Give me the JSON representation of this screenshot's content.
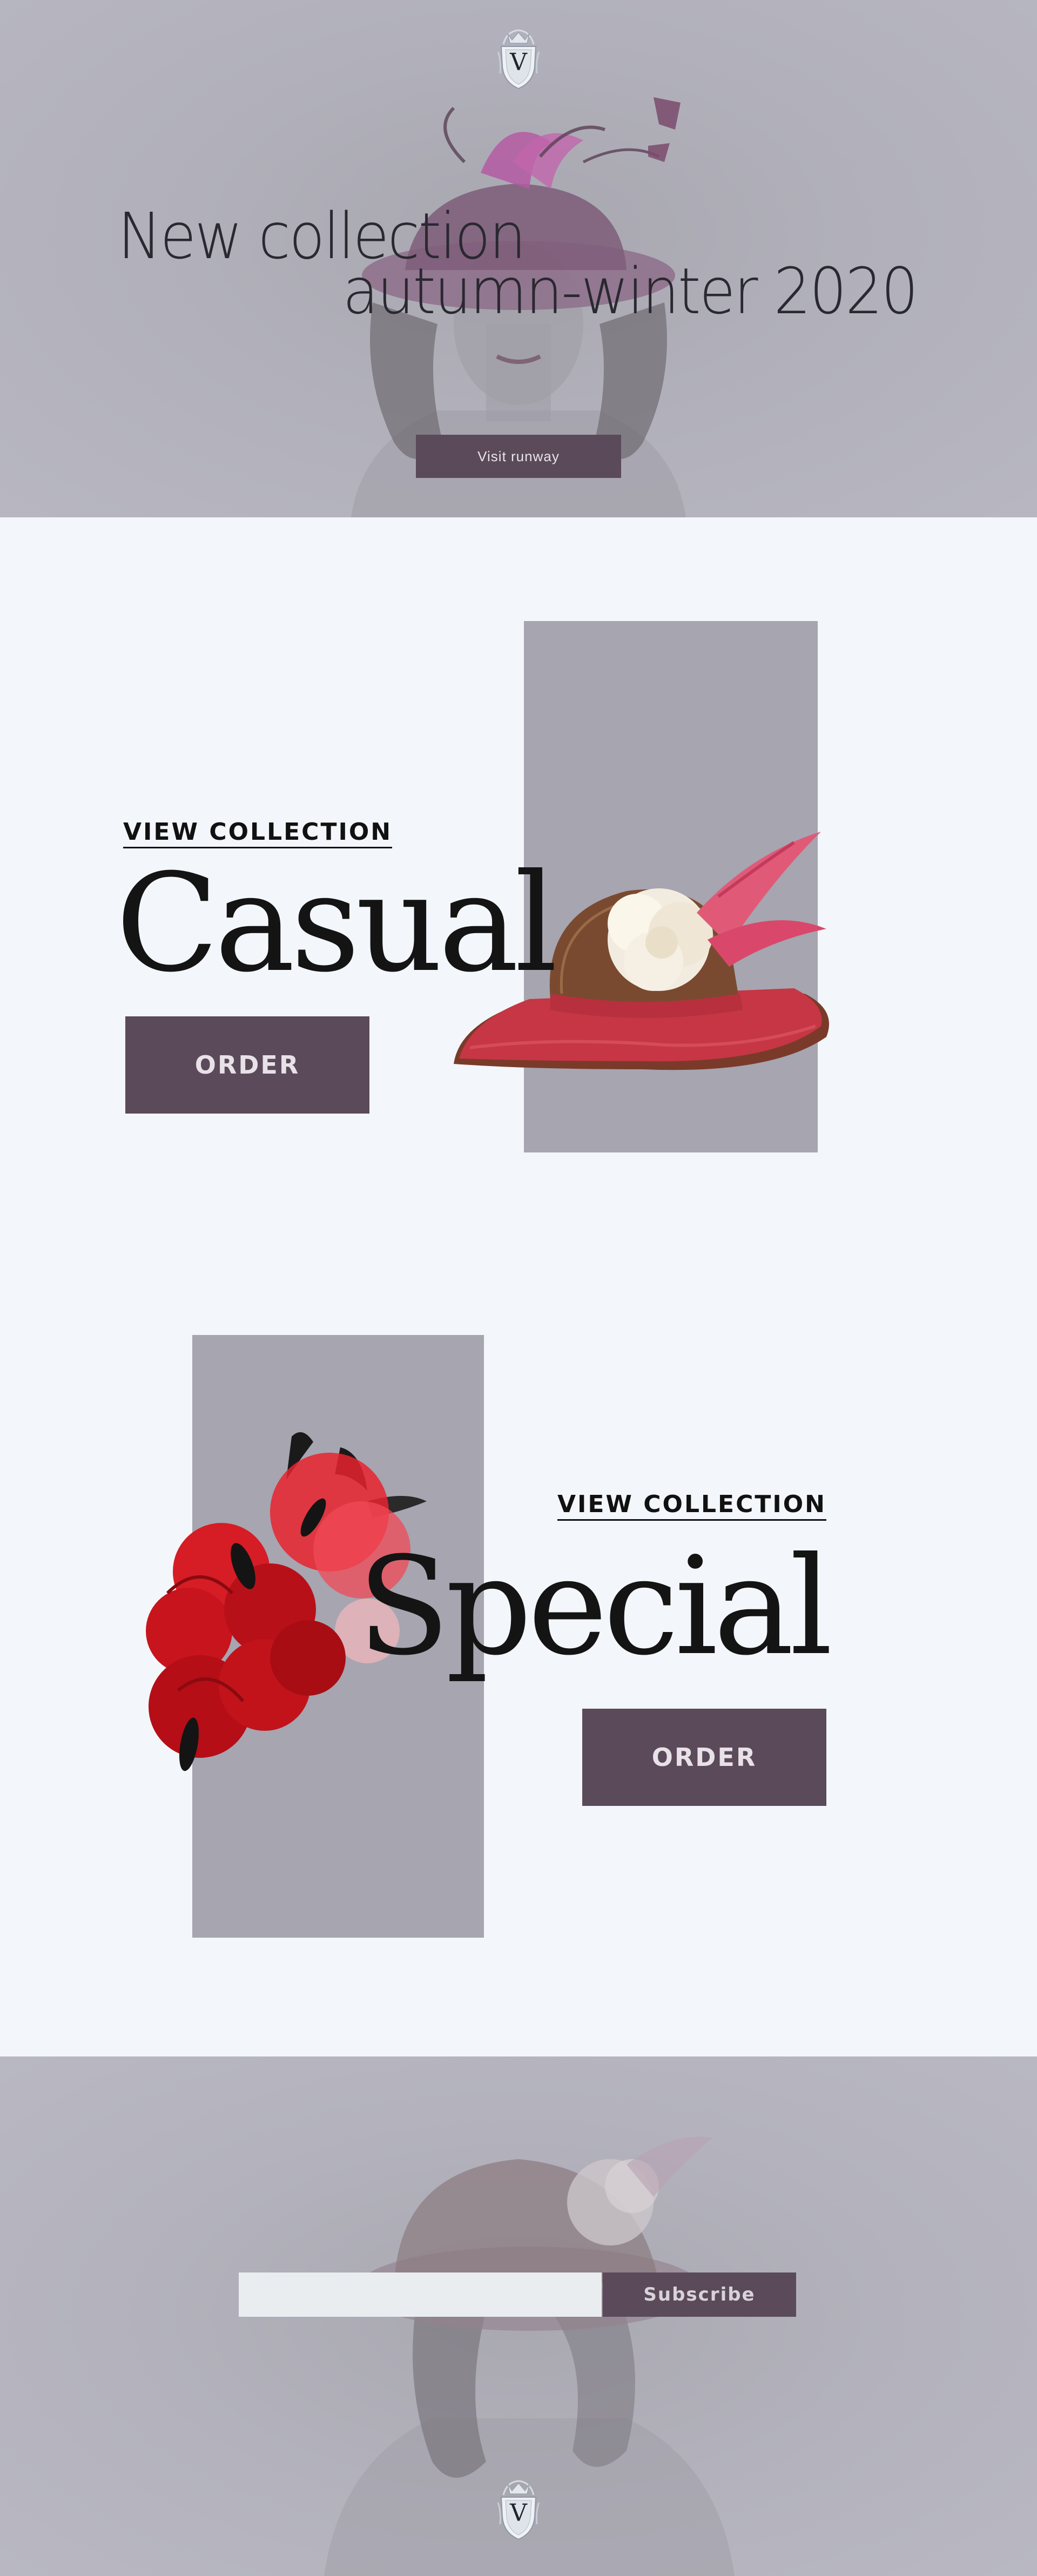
{
  "hero": {
    "title_line_1": "New collection",
    "title_line_2": "autumn-winter 2020",
    "runway_button": "Visit runway"
  },
  "brand": {
    "crest_letter": "V",
    "accent_color": "#5b4a5a",
    "hero_bg_color": "#b3b2bc",
    "page_bg_color": "#f3f6fa",
    "panel_color": "#a6a5b0"
  },
  "collections": [
    {
      "link_label": "VIEW COLLECTION",
      "title": "Casual",
      "order_label": "ORDER",
      "image_icon": "red-brim-hat-with-white-flower-icon"
    },
    {
      "link_label": "VIEW COLLECTION",
      "title": "Special",
      "order_label": "ORDER",
      "image_icon": "red-flower-fascinator-icon"
    }
  ],
  "footer": {
    "email_placeholder": "",
    "subscribe_label": "Subscribe"
  }
}
